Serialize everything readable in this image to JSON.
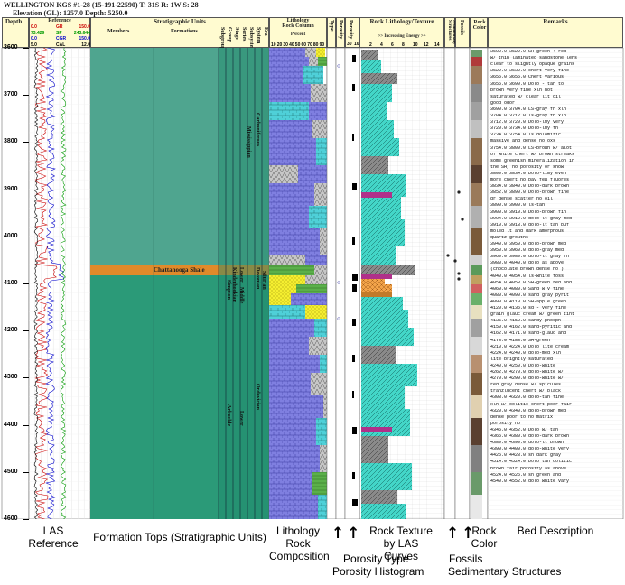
{
  "header": {
    "line1": "WELLINGTON KGS #1-28 (15-191-22590) T: 31S R: 1W S: 28",
    "line2": "Elevation (GL): 1257.0 Depth: 5250.0"
  },
  "columns": {
    "depth": "Depth",
    "reference": "Reference",
    "strat_units": "Stratigraphic Units",
    "members": "Members",
    "formations": "Formations",
    "strat_vertical": [
      "Subgroup",
      "Group",
      "Stage",
      "Series",
      "Subsystem",
      "System",
      "Era"
    ],
    "lithology": "Lithology",
    "rock_column": "Rock Column",
    "percent": "Percent",
    "percent_ticks": [
      "10",
      "20",
      "30",
      "40",
      "50",
      "60",
      "70",
      "80",
      "90"
    ],
    "type": "Type",
    "porosity": "Porosity",
    "porosity_col": "Porosity",
    "porosity_ticks": [
      "30",
      "10"
    ],
    "rock_texture": "Rock Lithology/Texture",
    "energy": ">> Increasing Energy >>",
    "energy_ticks": [
      "2",
      "4",
      "6",
      "8",
      "10",
      "12",
      "14"
    ],
    "sed_structures": "Sedimentary Structures",
    "fossils": "Fossils",
    "rock_color": "Rock Color",
    "remarks": "Remarks"
  },
  "log_scales": [
    {
      "curve": "GR",
      "min": "0.0",
      "max": "150.0",
      "color": "#cc0000"
    },
    {
      "curve": "SP",
      "min": "73.429",
      "max": "243.644",
      "color": "#009900"
    },
    {
      "curve": "CGR",
      "min": "0.0",
      "max": "150.0",
      "color": "#0000cc"
    },
    {
      "curve": "CAL",
      "min": "5.0",
      "max": "12.0",
      "color": "#000000"
    }
  ],
  "depths": [
    "3600",
    "3700",
    "3800",
    "3900",
    "4000",
    "4100",
    "4200",
    "4300",
    "4400",
    "4500",
    "4600"
  ],
  "strat": {
    "chattanooga": "Chattanooga Shale",
    "carboniferous": "Carboniferous",
    "mississippian": "Mississippian",
    "devonian": "Devonian",
    "silurian": "Silurian",
    "ordovician": "Ordovician",
    "simpson": "Simpson",
    "kinderhookian": "Kinderhookian",
    "lower": "Lower",
    "middle": "Middle",
    "arbuckle": "Arbuckle",
    "lower2": "Lower"
  },
  "remarks": [
    "3600.0 3622.0 SH-green + red",
    "w/ thin laminated sandstone lens",
    "clear to slightly opaque grains",
    "3622.0 3630.0 chert very fine",
    "3656.0 3656.0 Chert various",
    "3656.0 3690.0 Dolo - tan to",
    "brown very fine xln not",
    "saturated w/ clear lit oil",
    "good odor",
    "3690.0 3704.0 LS-gray fn xln",
    "3704.0 3712.0 ls-gray fn xln",
    "3712.0 3720.0 Dolo-lmy very",
    "3720.0 3734.0 Dolo-lmy fn",
    "3734.0 3754.0 ls dolomitic",
    "massive and dense no oxs",
    "3754.0 3800.0 LS-brown w/ alot",
    "of white chert w/ brown streaks",
    "some greenish mineralization in",
    "the SH, no porosity or show",
    "3800.0 3834.0 Dolo-limy even",
    "more chert no pay few fluores",
    "3834.0 3840.0 Dolo-dark brown",
    "3852.0 3890.0 Dolo-brown fine",
    "gr dense scatter no oil",
    "3890.0 3900.0 ls-tan",
    "3900.0 3910.0 Dolo-brown fin",
    "3904.0 3910.0 dolo-lt gray med",
    "3910.0 3918.0 dolo-lt tan buf",
    "moled lt and dark amorphous",
    "quartz growths",
    "3940.0 3950.0 dolo-brown med",
    "3950.0 3960.0 dolo-gray med",
    "3960.0 3980.0 dolo-lt gray fn",
    "3980.0 4040.0 dolo as above",
    "(chocolate brown dense no )",
    "4040.0 4054.0 ls-white foss",
    "4054.0 4058.0 SH-green red and",
    "4060.0 4080.0 Sand w v fine",
    "4080.0 4090.0 sand gray pyrit",
    "4090.0 4110.0 SH-apple green",
    "4120.0 4136.0 sd - very fine",
    "grain glauc cream w/ green tint",
    "4136.0 4150.0 sandy phosph",
    "4150.0 4162.0 sand-pyritic and",
    "4162.0 4171.0 sand-glauc and",
    "4178.0 4188.0 SH-green",
    "4210.0 4224.0 Dolo lite cream",
    "4224.0 4240.0 dolo-med xln",
    "lite brightly saturated",
    "4240.0 4250.0 Dolo-white",
    "4262.0 4270.0 dolo-white w/",
    "4270.0 4290.0 dolo-white w/",
    "red gray dense w/ spicules",
    "tranzlucent chert w/ black",
    "4303.0 4320.0 dolo-tan fine",
    "xln w/ oolitic chert poor fair",
    "4320.0 4340.0 dolo-brown med",
    "dense poor to no matrix",
    "porosity no",
    "4346.0 4352.0 Dolo w/ tan",
    "4366.0 4380.0 dolo-dark brown",
    "4380.0 4390.0 dolo-lt brown",
    "4390.0 4400.0 dolo-white very",
    "4426.0 4428.0 sh dark gray",
    "4514.0 4524.0 Dolo tan oolitic",
    "brown fair porosity as above",
    "4524.0 4526.0 sh green and",
    "4540.0 4552.0 dolo white vary"
  ],
  "captions": {
    "las_reference": "LAS Reference",
    "formation_tops": "Formation Tops (Stratigraphic Units)",
    "lithology": "Lithology Rock Composition",
    "porosity_type": "Porosity Type",
    "porosity_histogram": "Porosity Histogram",
    "rock_texture": "Rock Texture by LAS Curves",
    "fossils": "Fossils",
    "sed_structures": "Sedimentary Structures",
    "rock_color": "Rock Color",
    "bed_description": "Bed Description"
  }
}
